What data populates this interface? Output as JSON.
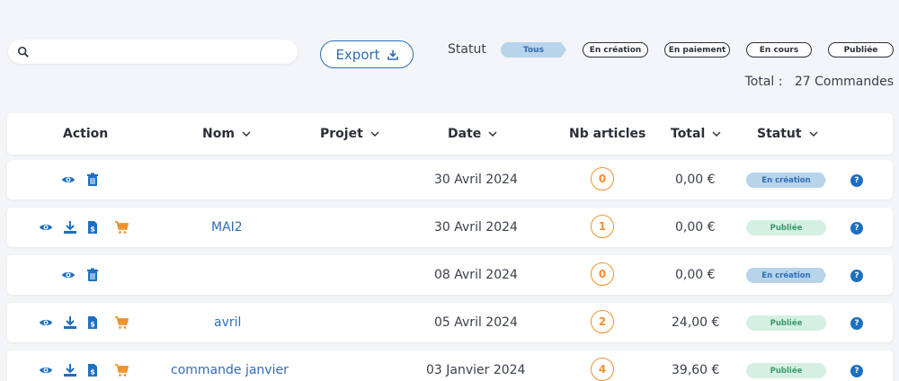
{
  "search": {
    "placeholder": "",
    "value": ""
  },
  "export_label": "Export",
  "statut_label": "Statut",
  "filters": [
    "Tous",
    "En création",
    "En paiement",
    "En cours",
    "Publiée"
  ],
  "total": {
    "label": "Total :",
    "value": "27 Commandes"
  },
  "columns": [
    "Action",
    "Nom",
    "Projet",
    "Date",
    "Nb articles",
    "Total",
    "Statut"
  ],
  "rows": [
    {
      "nom": "",
      "projet": "",
      "date": "30 Avril 2024",
      "nb": "0",
      "total": "0,00 €",
      "statut": "En création",
      "actions": [
        "eye-icon",
        "trash-icon"
      ]
    },
    {
      "nom": "MAI2",
      "projet": "",
      "date": "30 Avril 2024",
      "nb": "1",
      "total": "0,00 €",
      "statut": "Publiée",
      "actions": [
        "eye-icon",
        "download-icon",
        "invoice-icon",
        "cart-icon"
      ]
    },
    {
      "nom": "",
      "projet": "",
      "date": "08 Avril 2024",
      "nb": "0",
      "total": "0,00 €",
      "statut": "En création",
      "actions": [
        "eye-icon",
        "trash-icon"
      ]
    },
    {
      "nom": "avril",
      "projet": "",
      "date": "05 Avril 2024",
      "nb": "2",
      "total": "24,00 €",
      "statut": "Publiée",
      "actions": [
        "eye-icon",
        "download-icon",
        "invoice-icon",
        "cart-icon"
      ]
    },
    {
      "nom": "commande janvier",
      "projet": "",
      "date": "03 Janvier 2024",
      "nb": "4",
      "total": "39,60 €",
      "statut": "Publiée",
      "actions": [
        "eye-icon",
        "download-icon",
        "invoice-icon",
        "cart-icon"
      ]
    }
  ],
  "help_glyph": "?",
  "colors": {
    "accent": "#2f6db8",
    "orange": "#f0922e",
    "creation_bg": "#b7d4ea",
    "publiee_bg": "#d5f0e3"
  }
}
